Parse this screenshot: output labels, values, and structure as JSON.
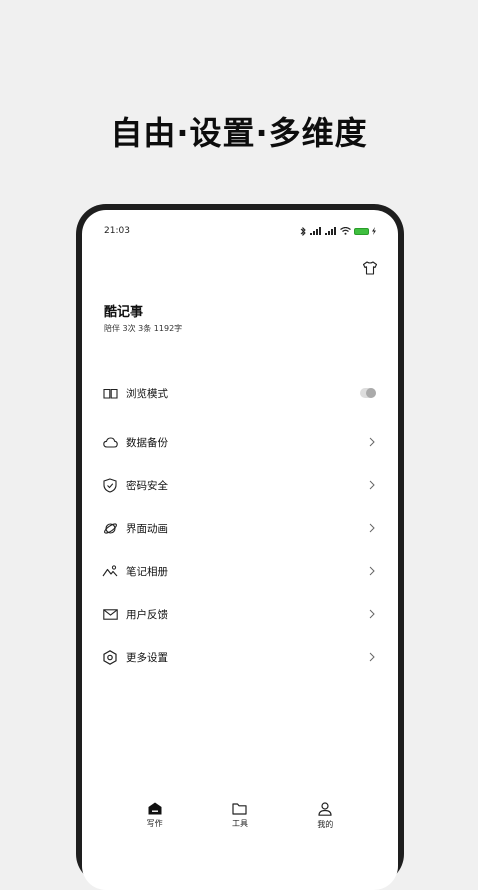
{
  "headline": "自由·设置·多维度",
  "status_bar": {
    "time": "21:03"
  },
  "profile": {
    "title": "酷记事",
    "subtitle": "陪伴 3次 3条 1192字"
  },
  "menu": [
    {
      "label": "浏览模式",
      "icon": "book-icon",
      "control": "toggle"
    },
    {
      "label": "数据备份",
      "icon": "cloud-icon",
      "control": "chevron"
    },
    {
      "label": "密码安全",
      "icon": "shield-icon",
      "control": "chevron"
    },
    {
      "label": "界面动画",
      "icon": "planet-icon",
      "control": "chevron"
    },
    {
      "label": "笔记相册",
      "icon": "image-icon",
      "control": "chevron"
    },
    {
      "label": "用户反馈",
      "icon": "mail-icon",
      "control": "chevron"
    },
    {
      "label": "更多设置",
      "icon": "hexagon-settings-icon",
      "control": "chevron"
    }
  ],
  "tabs": [
    {
      "label": "写作",
      "icon": "home-icon",
      "active": true
    },
    {
      "label": "工具",
      "icon": "folder-icon",
      "active": false
    },
    {
      "label": "我的",
      "icon": "person-icon",
      "active": false
    }
  ],
  "colors": {
    "battery": "#3fbf3f",
    "background": "#f0f0f0",
    "phone_frame": "#1e1e1e"
  }
}
